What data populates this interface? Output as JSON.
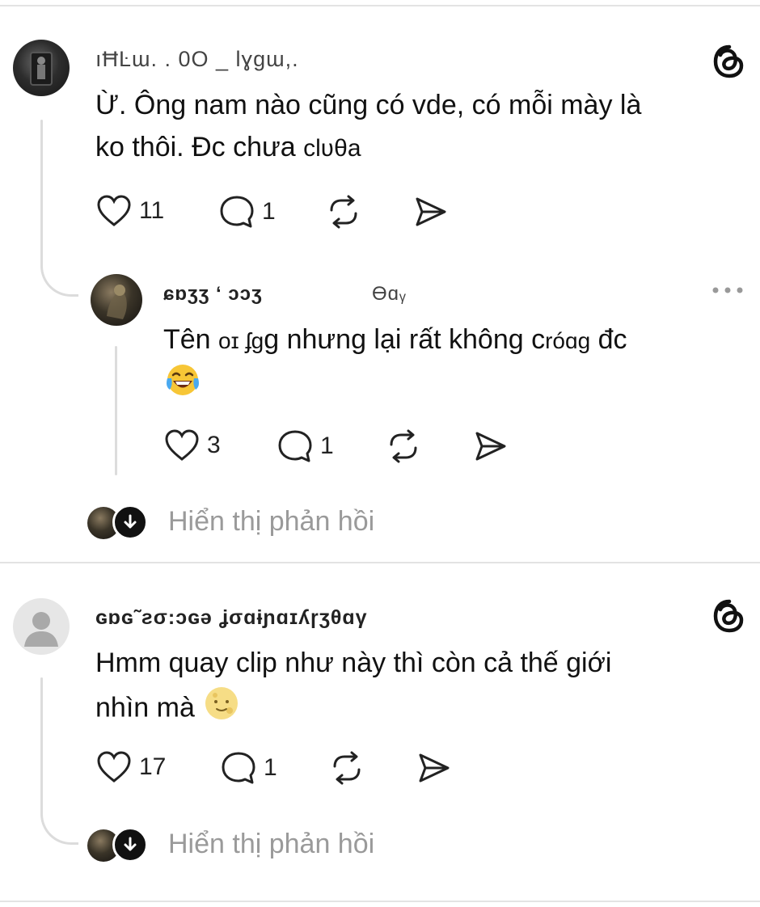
{
  "comments": [
    {
      "username": "ıĦĿɯ. . 0O _ lɣgɯ,.",
      "text_line1": "Ừ. Ông nam nào cũng có vde, có mỗi mày là",
      "text_line2": "ko thôi. Đc chưa",
      "text_tail": "clʋθa",
      "likes": "11",
      "replies": "1",
      "reply": {
        "username": "ɕɒʒʒ ‘ ɔɔʒ",
        "username_tail": "Ɵɑᵧ",
        "text_line1_a": "Tên",
        "text_line1_b": "οɪ ʄɡ",
        "text_line1_c": "g nhưng lại rất không c",
        "text_line1_d": "róɑg",
        "text_line1_e": "đc",
        "likes": "3",
        "replies": "1"
      },
      "show_replies": "Hiển thị phản hồi"
    },
    {
      "username": "ɢɒɢ˜ƨσ:ɔɢə ʝσɑɨɲɑɪʎɼʒθɑγ",
      "text_line1": "Hmm quay clip như này thì còn cả thế giới",
      "text_line2": "nhìn mà",
      "likes": "17",
      "replies": "1",
      "show_replies": "Hiển thị phản hồi"
    }
  ],
  "icons": {
    "brand": "threads-logo-icon",
    "like": "heart-icon",
    "reply": "comment-icon",
    "repost": "repost-icon",
    "share": "send-icon",
    "more": "more-dots-icon",
    "expand": "arrow-down-icon"
  },
  "colors": {
    "text": "#101010",
    "muted": "#9a9a9a",
    "line": "#dcdcdc"
  }
}
